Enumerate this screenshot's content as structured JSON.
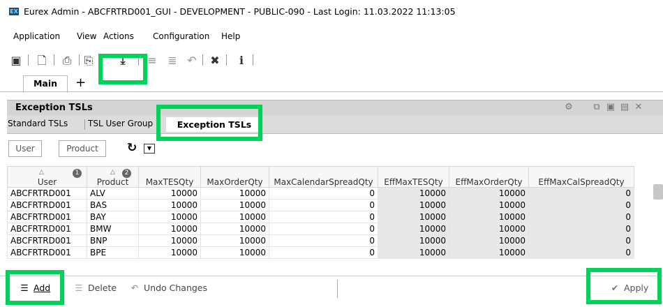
{
  "window": {
    "logo_text": "EX",
    "title": "Eurex Admin - ABCFRTRD001_GUI - DEVELOPMENT - PUBLIC-090 - Last Login: 11.03.2022 11:13:05"
  },
  "menubar": {
    "items": [
      "Application",
      "View",
      "Actions",
      "Configuration",
      "Help"
    ]
  },
  "toolbar": {
    "icons": [
      "exit-icon",
      "new-document-icon",
      "print-icon",
      "export-icon",
      "download-icon",
      "list-icon",
      "list-indent-icon",
      "undo-icon",
      "tools-icon",
      "info-icon"
    ]
  },
  "tabs": {
    "main_label": "Main",
    "add_label": "+"
  },
  "panel": {
    "title": "Exception TSLs",
    "subtabs": [
      "Standard TSLs",
      "TSL User Group",
      "Exception TSLs"
    ],
    "filters": {
      "user_label": "User",
      "product_label": "Product"
    }
  },
  "table": {
    "columns": [
      "User",
      "Product",
      "MaxTESQty",
      "MaxOrderQty",
      "MaxCalendarSpreadQty",
      "EffMaxTESQty",
      "EffMaxOrderQty",
      "EffMaxCalSpreadQty"
    ],
    "sort_badges": [
      "1",
      "2"
    ],
    "rows": [
      [
        "ABCFRTRD001",
        "ALV",
        "10000",
        "10000",
        "0",
        "10000",
        "10000",
        "0"
      ],
      [
        "ABCFRTRD001",
        "BAS",
        "10000",
        "10000",
        "0",
        "10000",
        "10000",
        "0"
      ],
      [
        "ABCFRTRD001",
        "BAY",
        "10000",
        "10000",
        "0",
        "10000",
        "10000",
        "0"
      ],
      [
        "ABCFRTRD001",
        "BMW",
        "10000",
        "10000",
        "0",
        "10000",
        "10000",
        "0"
      ],
      [
        "ABCFRTRD001",
        "BNP",
        "10000",
        "10000",
        "0",
        "10000",
        "10000",
        "0"
      ],
      [
        "ABCFRTRD001",
        "BPE",
        "10000",
        "10000",
        "0",
        "10000",
        "10000",
        "0"
      ]
    ]
  },
  "bottom_bar": {
    "add_label": "Add",
    "delete_label": "Delete",
    "undo_label": "Undo Changes",
    "apply_label": "Apply"
  },
  "colors": {
    "highlight": "#00d35a",
    "panel_header": "#d4d4d4",
    "shaded_cells": "#e8e8e8"
  }
}
